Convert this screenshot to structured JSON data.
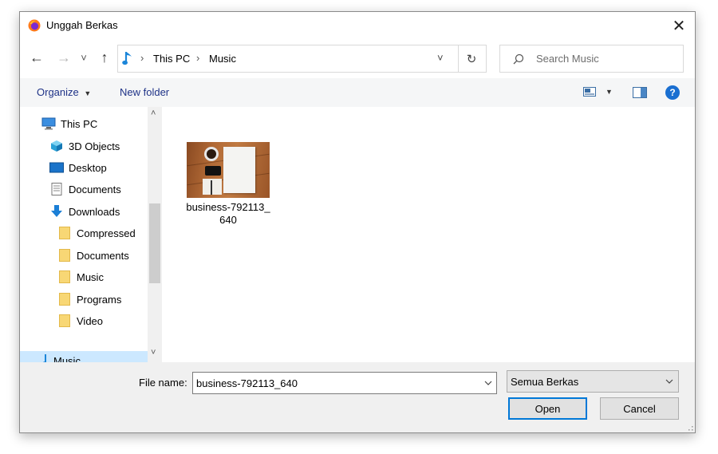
{
  "window": {
    "title": "Unggah Berkas",
    "close_glyph": "✕"
  },
  "nav": {
    "back_glyph": "←",
    "forward_glyph": "→",
    "recent_glyph": "˅",
    "up_glyph": "↑",
    "breadcrumb": [
      "This PC",
      "Music"
    ],
    "breadcrumb_sep": "›",
    "history_glyph": "˅",
    "refresh_glyph": "↻",
    "search_placeholder": "Search Music"
  },
  "toolbar": {
    "organize_label": "Organize",
    "new_folder_label": "New folder",
    "help_glyph": "?"
  },
  "sidebar": {
    "items": [
      {
        "label": "This PC",
        "icon": "computer-icon"
      },
      {
        "label": "3D Objects",
        "icon": "cube-icon"
      },
      {
        "label": "Desktop",
        "icon": "desktop-icon"
      },
      {
        "label": "Documents",
        "icon": "document-icon"
      },
      {
        "label": "Downloads",
        "icon": "download-icon"
      },
      {
        "label": "Compressed",
        "icon": "folder-icon"
      },
      {
        "label": "Documents",
        "icon": "folder-icon"
      },
      {
        "label": "Music",
        "icon": "folder-icon"
      },
      {
        "label": "Programs",
        "icon": "folder-icon"
      },
      {
        "label": "Video",
        "icon": "folder-icon"
      },
      {
        "label": "Music",
        "icon": "music-icon"
      }
    ],
    "scroll_up_glyph": "˄",
    "scroll_down_glyph": "˅"
  },
  "files": [
    {
      "name": "business-792113_640"
    }
  ],
  "bottom": {
    "file_name_label": "File name:",
    "file_name_value": "business-792113_640",
    "file_type_value": "Semua Berkas",
    "open_label": "Open",
    "cancel_label": "Cancel"
  },
  "colors": {
    "accent": "#0078d7",
    "link": "#1e3287",
    "folder": "#f8d775"
  }
}
